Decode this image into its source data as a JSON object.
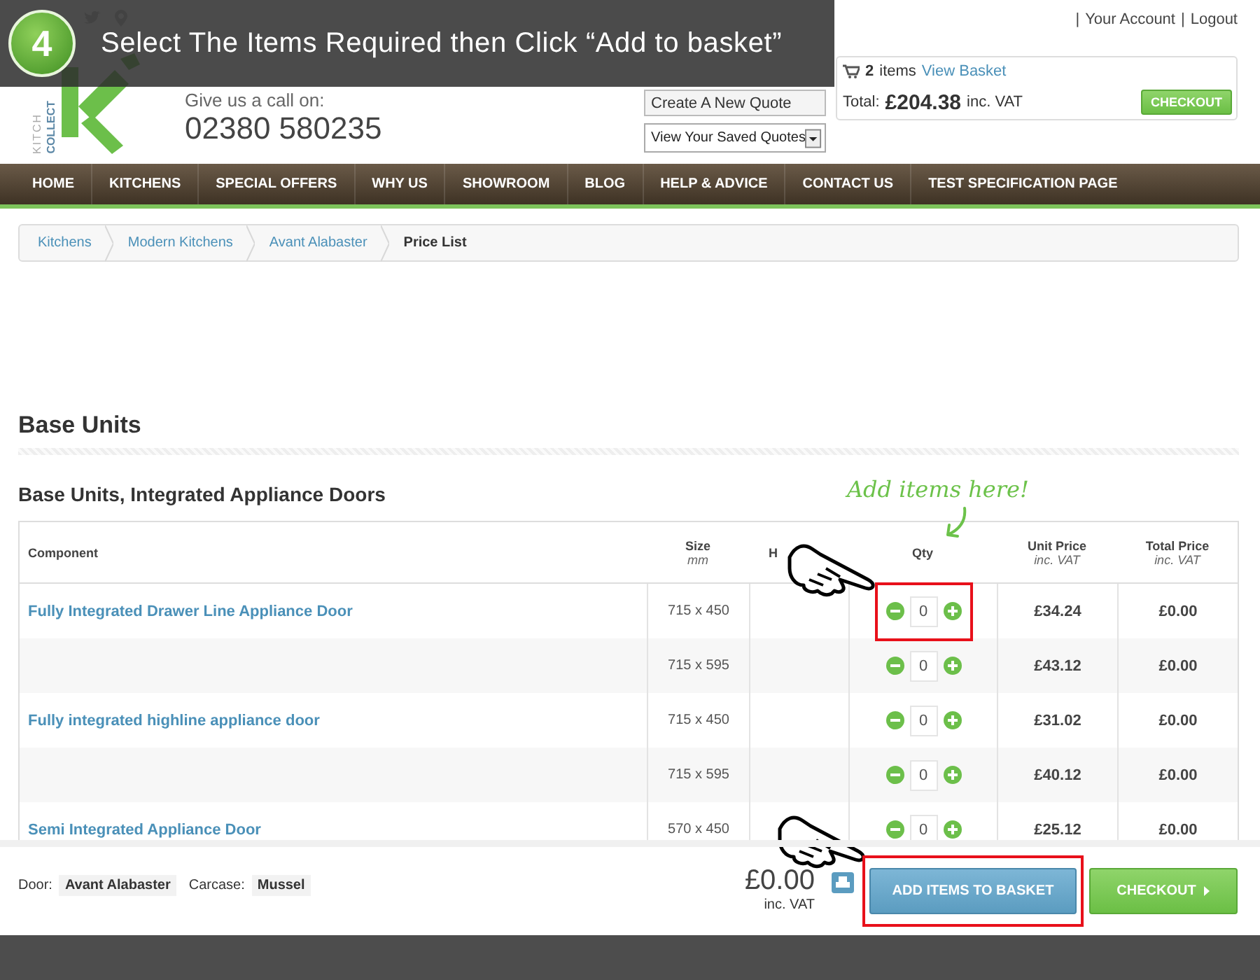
{
  "tutorial": {
    "step": "4",
    "instruction": "Select The Items Required then Click “Add to basket”"
  },
  "header": {
    "separator": "|",
    "account_links": [
      "Your Account",
      "Logout"
    ],
    "logo_texts": [
      "KITCH",
      "COLLECT"
    ],
    "phone_label": "Give us a call on:",
    "phone": "02380 580235",
    "create_quote_button": "Create A New Quote",
    "saved_quotes_select": "View Your Saved Quotes",
    "basket": {
      "count": "2",
      "count_label": "items",
      "link": "View Basket",
      "total_label": "Total:",
      "total": "£204.38",
      "vat": "inc. VAT",
      "checkout": "CHECKOUT"
    }
  },
  "nav": {
    "items": [
      "HOME",
      "KITCHENS",
      "SPECIAL OFFERS",
      "WHY US",
      "SHOWROOM",
      "BLOG",
      "HELP & ADVICE",
      "CONTACT US",
      "TEST SPECIFICATION PAGE"
    ]
  },
  "breadcrumb": [
    {
      "label": "Kitchens",
      "current": false
    },
    {
      "label": "Modern Kitchens",
      "current": false
    },
    {
      "label": "Avant Alabaster",
      "current": false
    },
    {
      "label": "Price List",
      "current": true
    }
  ],
  "section_title": "Base Units",
  "subsection_title": "Base Units, Integrated Appliance Doors",
  "annotation": "Add items here!",
  "table": {
    "columns": [
      {
        "label": "Component"
      },
      {
        "label": "Size",
        "sub": "mm"
      },
      {
        "label": "H"
      },
      {
        "label": "Qty"
      },
      {
        "label": "Unit Price",
        "sub": "inc. VAT"
      },
      {
        "label": "Total Price",
        "sub": "inc. VAT"
      }
    ],
    "rows": [
      {
        "component": "Fully Integrated Drawer Line Appliance Door",
        "size": "715 x 450",
        "qty": "0",
        "unit_price": "£34.24",
        "total_price": "£0.00",
        "highlighted": true
      },
      {
        "size": "715 x 595",
        "qty": "0",
        "unit_price": "£43.12",
        "total_price": "£0.00",
        "highlighted": false
      },
      {
        "component": "Fully integrated highline appliance door",
        "size": "715 x 450",
        "qty": "0",
        "unit_price": "£31.02",
        "total_price": "£0.00",
        "highlighted": false
      },
      {
        "size": "715 x 595",
        "qty": "0",
        "unit_price": "£40.12",
        "total_price": "£0.00",
        "highlighted": false
      },
      {
        "component": "Semi Integrated Appliance Door",
        "size": "570 x 450",
        "qty": "0",
        "unit_price": "£25.12",
        "total_price": "£0.00",
        "highlighted": false
      }
    ]
  },
  "footer": {
    "door_label": "Door:",
    "door": "Avant Alabaster",
    "carcase_label": "Carcase:",
    "carcase": "Mussel",
    "total": "£0.00",
    "vat": "inc. VAT",
    "add_button": {
      "label": "ADD ITEMS TO BASKET",
      "highlighted": true
    },
    "checkout": "CHECKOUT"
  }
}
